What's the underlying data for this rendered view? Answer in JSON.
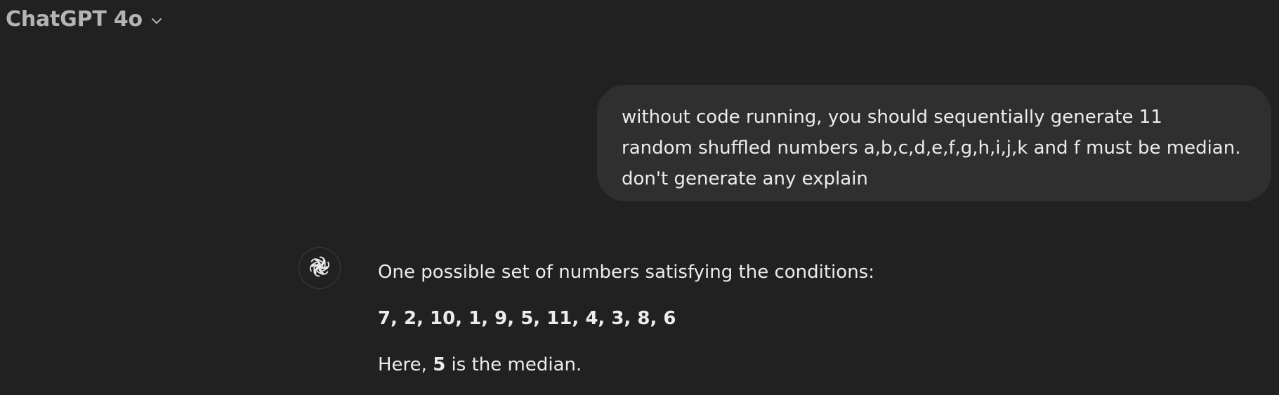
{
  "header": {
    "model_name": "ChatGPT 4o",
    "dropdown_icon": "chevron-down-icon"
  },
  "conversation": {
    "user_message": "without code running, you should sequentially generate 11\nrandom shuffled numbers a,b,c,d,e,f,g,h,i,j,k and f must be median.\ndon't generate any explain",
    "assistant": {
      "avatar_icon": "openai-logo-icon",
      "intro": "One possible set of numbers satisfying the conditions:",
      "numbers": "7, 2, 10, 1, 9, 5, 11, 4, 3, 8, 6",
      "conclusion_prefix": "Here, ",
      "median_value": "5",
      "conclusion_suffix": " is the median."
    }
  },
  "colors": {
    "background": "#212121",
    "user_bubble": "#2f2f2f",
    "text": "#ececec",
    "muted_text": "#b4b4b4"
  }
}
